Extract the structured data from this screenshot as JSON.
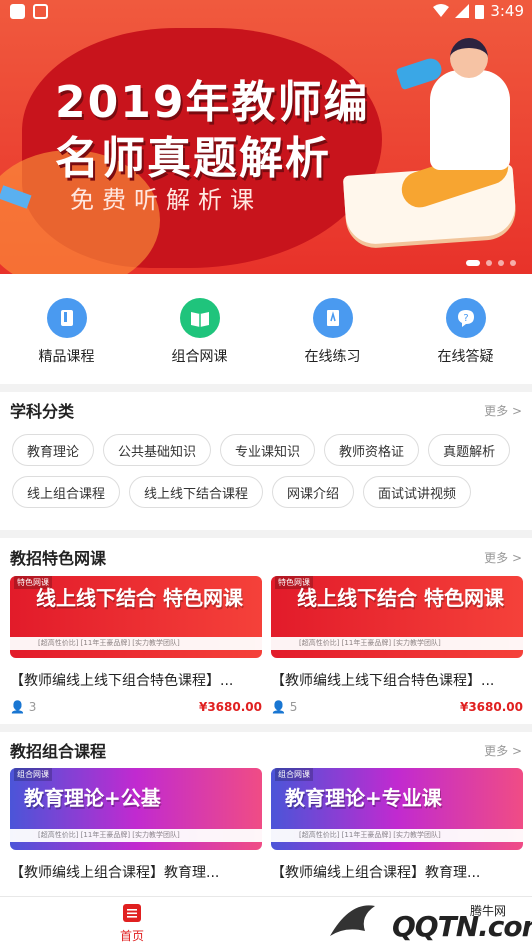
{
  "status_bar": {
    "time": "3:49"
  },
  "banner": {
    "line1": "2019年教师编",
    "line2": "名师真题解析",
    "line3": "免费听解析课"
  },
  "quick_nav": [
    {
      "label": "精品课程",
      "icon": "book-icon",
      "color": "#4a9af0"
    },
    {
      "label": "组合网课",
      "icon": "open-book-icon",
      "color": "#1fc47c"
    },
    {
      "label": "在线练习",
      "icon": "exercise-icon",
      "color": "#4a9af0"
    },
    {
      "label": "在线答疑",
      "icon": "question-icon",
      "color": "#4a9af0"
    }
  ],
  "subjects": {
    "title": "学科分类",
    "more": "更多 >",
    "tags": [
      "教育理论",
      "公共基础知识",
      "专业课知识",
      "教师资格证",
      "真题解析",
      "线上组合课程",
      "线上线下结合课程",
      "网课介绍",
      "面试试讲视频"
    ]
  },
  "featured": {
    "title": "教招特色网课",
    "more": "更多 >",
    "items": [
      {
        "banner_tag": "特色网课",
        "banner_title": "线上线下结合 特色网课",
        "banner_strip": "[超高性价比] [11年王豪品牌] [实力教学团队]",
        "title": "【教师编线上线下组合特色课程】...",
        "count": "3",
        "price": "¥3680.00"
      },
      {
        "banner_tag": "特色网课",
        "banner_title": "线上线下结合 特色网课",
        "banner_strip": "[超高性价比] [11年王豪品牌] [实力教学团队]",
        "title": "【教师编线上线下组合特色课程】...",
        "count": "5",
        "price": "¥3680.00"
      }
    ]
  },
  "combo": {
    "title": "教招组合课程",
    "more": "更多 >",
    "items": [
      {
        "banner_tag": "组合网课",
        "banner_title": "教育理论+公基",
        "banner_strip": "[超高性价比] [11年王豪品牌] [实力教学团队]",
        "title": "【教师编线上组合课程】教育理..."
      },
      {
        "banner_tag": "组合网课",
        "banner_title": "教育理论+专业课",
        "banner_strip": "[超高性价比] [11年王豪品牌] [实力教学团队]",
        "title": "【教师编线上组合课程】教育理..."
      }
    ]
  },
  "tabbar": {
    "home_label": "首页"
  },
  "watermark": {
    "brand": "QQTN.com",
    "top": "腾牛网",
    "bottom": ""
  },
  "colors": {
    "accent": "#e02020",
    "banner": "#e8322a"
  }
}
